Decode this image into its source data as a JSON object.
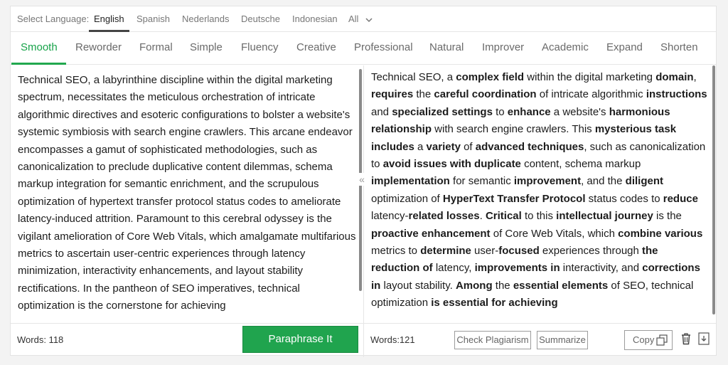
{
  "language": {
    "label": "Select Language:",
    "tabs": [
      "English",
      "Spanish",
      "Nederlands",
      "Deutsche",
      "Indonesian"
    ],
    "active": "English",
    "all_label": "All"
  },
  "modes": {
    "tabs": [
      "Smooth",
      "Reworder",
      "Formal",
      "Simple",
      "Fluency",
      "Creative",
      "Professional",
      "Natural",
      "Improver",
      "Academic",
      "Expand",
      "Shorten"
    ],
    "active": "Smooth"
  },
  "input_text": "Technical SEO, a labyrinthine discipline within the digital marketing spectrum, necessitates the meticulous orchestration of intricate algorithmic directives and esoteric configurations to bolster a website's systemic symbiosis with search engine crawlers. This arcane endeavor encompasses a gamut of sophisticated methodologies, such as canonicalization to preclude duplicative content dilemmas, schema markup integration for semantic enrichment, and the scrupulous optimization of hypertext transfer protocol status codes to ameliorate latency-induced attrition. Paramount to this cerebral odyssey is the vigilant amelioration of Core Web Vitals, which amalgamate multifarious metrics to ascertain user-centric experiences through latency minimization, interactivity enhancements, and layout stability rectifications. In the pantheon of SEO imperatives, technical optimization is the cornerstone for achieving",
  "output_segments": [
    {
      "t": "Technical SEO, a ",
      "b": false
    },
    {
      "t": "complex field",
      "b": true
    },
    {
      "t": " within the digital marketing ",
      "b": false
    },
    {
      "t": "domain",
      "b": true
    },
    {
      "t": ", ",
      "b": false
    },
    {
      "t": "requires",
      "b": true
    },
    {
      "t": " the ",
      "b": false
    },
    {
      "t": "careful coordination",
      "b": true
    },
    {
      "t": " of intricate algorithmic ",
      "b": false
    },
    {
      "t": "instructions",
      "b": true
    },
    {
      "t": " and ",
      "b": false
    },
    {
      "t": "specialized settings",
      "b": true
    },
    {
      "t": " to ",
      "b": false
    },
    {
      "t": "enhance",
      "b": true
    },
    {
      "t": " a website's ",
      "b": false
    },
    {
      "t": "harmonious relationship",
      "b": true
    },
    {
      "t": " with search engine crawlers. This ",
      "b": false
    },
    {
      "t": "mysterious task includes",
      "b": true
    },
    {
      "t": " a ",
      "b": false
    },
    {
      "t": "variety",
      "b": true
    },
    {
      "t": " of ",
      "b": false
    },
    {
      "t": "advanced techniques",
      "b": true
    },
    {
      "t": ", such as canonicalization to ",
      "b": false
    },
    {
      "t": "avoid issues with duplicate",
      "b": true
    },
    {
      "t": " content, schema markup ",
      "b": false
    },
    {
      "t": "implementation",
      "b": true
    },
    {
      "t": " for semantic ",
      "b": false
    },
    {
      "t": "improvement",
      "b": true
    },
    {
      "t": ", and the ",
      "b": false
    },
    {
      "t": "diligent",
      "b": true
    },
    {
      "t": " optimization of ",
      "b": false
    },
    {
      "t": "HyperText Transfer Protocol",
      "b": true
    },
    {
      "t": " status codes to ",
      "b": false
    },
    {
      "t": "reduce",
      "b": true
    },
    {
      "t": " latency-",
      "b": false
    },
    {
      "t": "related losses",
      "b": true
    },
    {
      "t": ". ",
      "b": false
    },
    {
      "t": "Critical",
      "b": true
    },
    {
      "t": " to this ",
      "b": false
    },
    {
      "t": "intellectual journey",
      "b": true
    },
    {
      "t": " is the ",
      "b": false
    },
    {
      "t": "proactive enhancement",
      "b": true
    },
    {
      "t": " of Core Web Vitals, which ",
      "b": false
    },
    {
      "t": "combine various",
      "b": true
    },
    {
      "t": " metrics to ",
      "b": false
    },
    {
      "t": "determine",
      "b": true
    },
    {
      "t": " user-",
      "b": false
    },
    {
      "t": "focused",
      "b": true
    },
    {
      "t": " experiences through ",
      "b": false
    },
    {
      "t": "the reduction of",
      "b": true
    },
    {
      "t": " latency, ",
      "b": false
    },
    {
      "t": "improvements in",
      "b": true
    },
    {
      "t": " interactivity, and ",
      "b": false
    },
    {
      "t": "corrections in",
      "b": true
    },
    {
      "t": " layout stability. ",
      "b": false
    },
    {
      "t": "Among",
      "b": true
    },
    {
      "t": " the ",
      "b": false
    },
    {
      "t": "essential elements",
      "b": true
    },
    {
      "t": " of SEO, technical optimization ",
      "b": false
    },
    {
      "t": "is essential for achieving",
      "b": true
    }
  ],
  "footer": {
    "words_left": "Words: 118",
    "paraphrase_label": "Paraphrase It",
    "words_right": "Words:121",
    "check_plagiarism_label": "Check Plagiarism",
    "summarize_label": "Summarize",
    "copy_label": "Copy"
  },
  "colors": {
    "accent": "#20a44e",
    "active_mode_text": "#18a34a"
  },
  "icons": [
    "chevron-down-icon",
    "collapse-arrows-icon",
    "copy-icon",
    "trash-icon",
    "download-icon"
  ]
}
